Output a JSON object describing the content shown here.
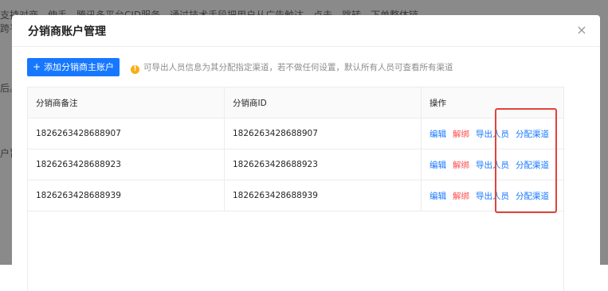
{
  "background": {
    "line1": "支持对商，伸手，腾讯多平台CID服务，通过技术手段把用户从广告触达，点击，跳转，下单整体链",
    "line2": "跨平",
    "line3": "后。",
    "line4": "户旨"
  },
  "modal": {
    "title": "分销商账户管理",
    "close_icon": "×",
    "add_button_label": "添加分销商主账户",
    "add_button_icon": "+",
    "hint_icon": "!",
    "hint_text": "可导出人员信息为其分配指定渠道，若不做任何设置，默认所有人员可查看所有渠道"
  },
  "table": {
    "headers": [
      "分销商备注",
      "分销商ID",
      "操作"
    ],
    "rows": [
      {
        "note": "1826263428688907",
        "id": "1826263428688907"
      },
      {
        "note": "1826263428688923",
        "id": "1826263428688923"
      },
      {
        "note": "1826263428688939",
        "id": "1826263428688939"
      }
    ],
    "actions": {
      "edit": "编辑",
      "unbind": "解绑",
      "export": "导出人员",
      "assign": "分配渠道"
    }
  },
  "colors": {
    "primary": "#1677ff",
    "danger": "#ff4d4f",
    "highlight": "#e0433b",
    "warning": "#faad14"
  }
}
